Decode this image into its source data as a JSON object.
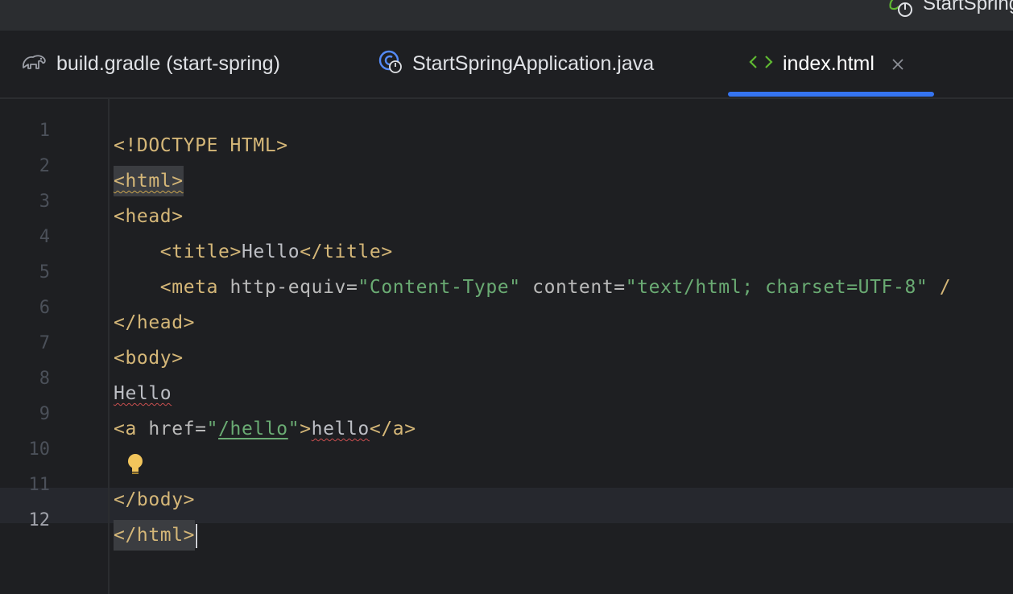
{
  "toolbar": {
    "run_config_label": "StartSpring",
    "run_config_icon": "spring-boot-run-icon"
  },
  "tabs": [
    {
      "label": "build.gradle (start-spring)",
      "icon": "gradle-elephant-icon",
      "active": false
    },
    {
      "label": "StartSpringApplication.java",
      "icon": "spring-app-class-icon",
      "active": false
    },
    {
      "label": "index.html",
      "icon": "html-brackets-icon",
      "active": true
    }
  ],
  "editor": {
    "current_line": 12,
    "line_numbers": [
      "1",
      "2",
      "3",
      "4",
      "5",
      "6",
      "7",
      "8",
      "9",
      "10",
      "11",
      "12"
    ],
    "code": {
      "l1": "<!DOCTYPE HTML>",
      "l2": "<html>",
      "l3": "<head>",
      "l4_indent": "    ",
      "l4_open": "<title>",
      "l4_text": "Hello",
      "l4_close": "</title>",
      "l5_indent": "    ",
      "l5_tag": "<meta",
      "l5_attr1": " http-equiv=",
      "l5_val1": "\"Content-Type\"",
      "l5_attr2": " content=",
      "l5_val2": "\"text/html; charset=UTF-8\"",
      "l5_end": " /",
      "l6": "</head>",
      "l7": "<body>",
      "l8": "Hello",
      "l9_open": "<a",
      "l9_attr": " href=",
      "l9_q1": "\"",
      "l9_link": "/hello",
      "l9_q2": "\"",
      "l9_gt": ">",
      "l9_text": "hello",
      "l9_close": "</a>",
      "l11": "</body>",
      "l12": "</html>"
    }
  },
  "colors": {
    "accent": "#3574f0",
    "tag": "#d5b778",
    "string": "#6aab73",
    "text": "#bcbec4",
    "background": "#1e1f22"
  }
}
